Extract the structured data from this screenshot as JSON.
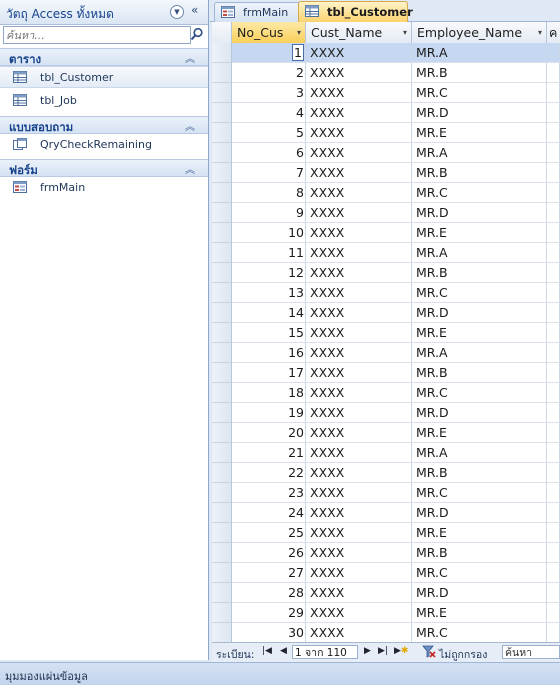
{
  "nav": {
    "title": "วัตถุ Access ทั้งหมด",
    "search_placeholder": "ค้นหา...",
    "groups": [
      {
        "title": "ตาราง",
        "items": [
          "tbl_Customer",
          "tbl_Job"
        ]
      },
      {
        "title": "แบบสอบถาม",
        "items": [
          "QryCheckRemaining"
        ]
      },
      {
        "title": "ฟอร์ม",
        "items": [
          "frmMain"
        ]
      }
    ]
  },
  "tabs": [
    {
      "label": "frmMain"
    },
    {
      "label": "tbl_Customer"
    }
  ],
  "columns": [
    "No_Cus",
    "Cust_Name",
    "Employee_Name",
    "ค"
  ],
  "rows": [
    {
      "no": "1",
      "name": "XXXX",
      "emp": "MR.A"
    },
    {
      "no": "2",
      "name": "XXXX",
      "emp": "MR.B"
    },
    {
      "no": "3",
      "name": "XXXX",
      "emp": "MR.C"
    },
    {
      "no": "4",
      "name": "XXXX",
      "emp": "MR.D"
    },
    {
      "no": "5",
      "name": "XXXX",
      "emp": "MR.E"
    },
    {
      "no": "6",
      "name": "XXXX",
      "emp": "MR.A"
    },
    {
      "no": "7",
      "name": "XXXX",
      "emp": "MR.B"
    },
    {
      "no": "8",
      "name": "XXXX",
      "emp": "MR.C"
    },
    {
      "no": "9",
      "name": "XXXX",
      "emp": "MR.D"
    },
    {
      "no": "10",
      "name": "XXXX",
      "emp": "MR.E"
    },
    {
      "no": "11",
      "name": "XXXX",
      "emp": "MR.A"
    },
    {
      "no": "12",
      "name": "XXXX",
      "emp": "MR.B"
    },
    {
      "no": "13",
      "name": "XXXX",
      "emp": "MR.C"
    },
    {
      "no": "14",
      "name": "XXXX",
      "emp": "MR.D"
    },
    {
      "no": "15",
      "name": "XXXX",
      "emp": "MR.E"
    },
    {
      "no": "16",
      "name": "XXXX",
      "emp": "MR.A"
    },
    {
      "no": "17",
      "name": "XXXX",
      "emp": "MR.B"
    },
    {
      "no": "18",
      "name": "XXXX",
      "emp": "MR.C"
    },
    {
      "no": "19",
      "name": "XXXX",
      "emp": "MR.D"
    },
    {
      "no": "20",
      "name": "XXXX",
      "emp": "MR.E"
    },
    {
      "no": "21",
      "name": "XXXX",
      "emp": "MR.A"
    },
    {
      "no": "22",
      "name": "XXXX",
      "emp": "MR.B"
    },
    {
      "no": "23",
      "name": "XXXX",
      "emp": "MR.C"
    },
    {
      "no": "24",
      "name": "XXXX",
      "emp": "MR.D"
    },
    {
      "no": "25",
      "name": "XXXX",
      "emp": "MR.E"
    },
    {
      "no": "26",
      "name": "XXXX",
      "emp": "MR.B"
    },
    {
      "no": "27",
      "name": "XXXX",
      "emp": "MR.C"
    },
    {
      "no": "28",
      "name": "XXXX",
      "emp": "MR.D"
    },
    {
      "no": "29",
      "name": "XXXX",
      "emp": "MR.E"
    },
    {
      "no": "30",
      "name": "XXXX",
      "emp": "MR.C"
    }
  ],
  "record_nav": {
    "label": "ระเบียน:",
    "position": "1 จาก 110",
    "filter_label": "ไม่ถูกกรอง",
    "search_placeholder": "ค้นหา"
  },
  "status": {
    "text": "มุมมองแผ่นข้อมูล"
  },
  "colors": {
    "accent": "#f9cf5a",
    "selection": "#c6d8f1",
    "nav_text": "#15428b"
  }
}
